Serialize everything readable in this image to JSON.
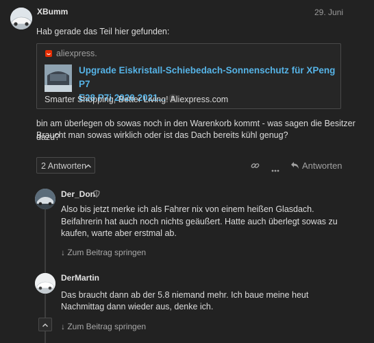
{
  "post": {
    "author": "XBumm",
    "date": "29. Juni",
    "intro": "Hab gerade das Teil hier gefunden:",
    "onebox": {
      "site": "aliexpress.",
      "title_line1": "Upgrade Eiskristall-Schiebedach-Sonnenschutz für XPeng P7",
      "title_line2": "E28 P7i 2020 2021...",
      "click_count": "9",
      "description": "Smarter Shopping, Better Living! Aliexpress.com"
    },
    "body_line1": "bin am überlegen ob sowas noch in den Warenkorb kommt - was sagen die Besitzer dazu?",
    "body_line2": "Braucht man sowas wirklich oder ist das Dach bereits kühl genug?"
  },
  "actions": {
    "replies_toggle": "2 Antworten",
    "reply_label": "Antworten"
  },
  "replies": [
    {
      "author": "Der_Don",
      "line1": "Also bis jetzt merke ich als Fahrer nix von einem heißen Glasdach.",
      "line2": "Beifahrerin hat auch noch nichts geäußert. Hatte auch überlegt sowas zu",
      "line3": "kaufen, warte aber erstmal ab.",
      "jump": "Zum Beitrag springen"
    },
    {
      "author": "DerMartin",
      "line1": "Das braucht dann ab der 5.8 niemand mehr. Ich baue meine heut",
      "line2": "Nachmittag dann wieder aus, denke ich.",
      "jump": "Zum Beitrag springen"
    }
  ],
  "colors": {
    "background": "#222222",
    "link": "#56b3e6",
    "aliexpress": "#e62e04"
  }
}
